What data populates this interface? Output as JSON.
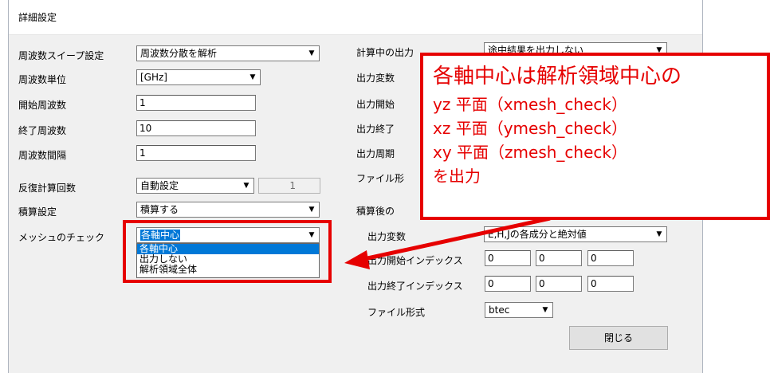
{
  "window": {
    "title": "詳細設定"
  },
  "left": {
    "sweep_label": "周波数スイープ設定",
    "sweep_value": "周波数分散を解析",
    "unit_label": "周波数単位",
    "unit_value": "[GHz]",
    "start_label": "開始周波数",
    "start_value": "1",
    "end_label": "終了周波数",
    "end_value": "10",
    "step_label": "周波数間隔",
    "step_value": "1",
    "iter_label": "反復計算回数",
    "iter_mode": "自動設定",
    "iter_value": "1",
    "accum_label": "積算設定",
    "accum_value": "積算する",
    "mesh_label": "メッシュのチェック",
    "mesh_value": "各軸中心",
    "mesh_options": [
      "各軸中心",
      "出力しない",
      "解析領域全体"
    ]
  },
  "right": {
    "calc_label": "計算中の出力",
    "calc_value": "途中結果を出力しない",
    "out_var_label": "出力変数",
    "out_start_label": "出力開始",
    "out_end_label": "出力終了",
    "out_period_label": "出力周期",
    "file_label": "ファイル形",
    "after_label": "積算後の",
    "var2_label": "出力変数",
    "var2_value": "E,H,Jの各成分と絶対値",
    "start_idx_label": "出力開始インデックス",
    "start_idx": [
      "0",
      "0",
      "0"
    ],
    "end_idx_label": "出力終了インデックス",
    "end_idx": [
      "0",
      "0",
      "0"
    ],
    "file2_label": "ファイル形式",
    "file2_value": "btec",
    "close_label": "閉じる"
  },
  "callout": {
    "line1": "各軸中心は解析領域中心の",
    "line2": "yz 平面（xmesh_check）",
    "line3": "xz 平面（ymesh_check）",
    "line4": "xy 平面（zmesh_check）",
    "line5": "を出力"
  },
  "colors": {
    "annotation_red": "#e60000",
    "selection_blue": "#0078d7"
  }
}
